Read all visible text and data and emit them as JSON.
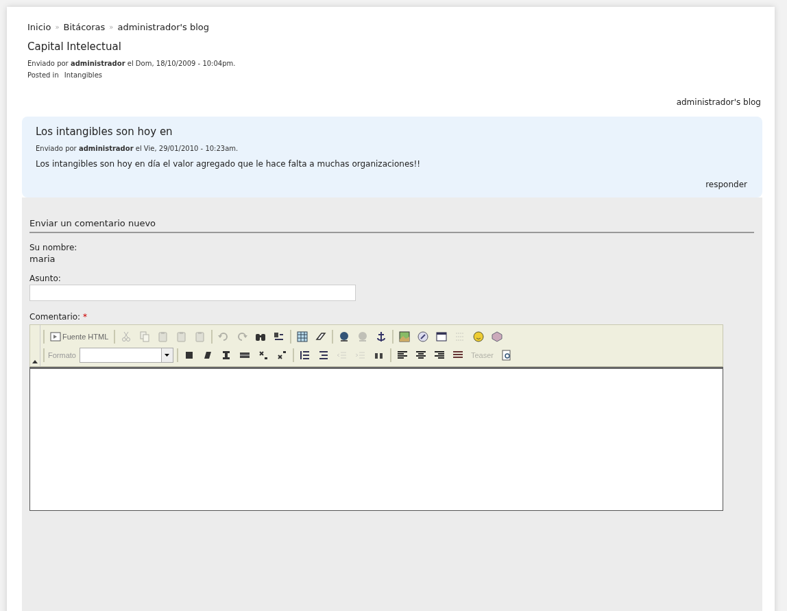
{
  "breadcrumb": [
    {
      "label": "Inicio"
    },
    {
      "label": "Bitácoras"
    },
    {
      "label": "administrador's blog"
    }
  ],
  "breadcrumb_separator": "»",
  "post": {
    "title": "Capital Intelectual",
    "submitted": "Enviado por **administrador** el Dom, 18/10/2009 - 10:04pm.",
    "posted_in_label": "Posted in",
    "term": "Intangibles",
    "blog_link": "administrador's blog"
  },
  "comment": {
    "title": "Los intangibles son hoy en",
    "submitted": "Enviado por **administrador** el Vie, 29/01/2010 - 10:23am.",
    "body": "Los intangibles son hoy en día el valor agregado que le hace falta a muchas organizaciones!!",
    "reply": "responder"
  },
  "form": {
    "heading": "Enviar un comentario nuevo",
    "name_label": "Su nombre:",
    "name_value": "maria",
    "subject_label": "Asunto:",
    "comment_label": "Comentario:",
    "required_mark": "*"
  },
  "toolbar": {
    "rows": [
      [
        {
          "kind": "sep"
        },
        {
          "kind": "button",
          "label": "Fuente HTML",
          "disabled": false
        },
        {
          "kind": "sep"
        },
        {
          "kind": "button",
          "disabled": true
        },
        {
          "kind": "button",
          "disabled": true
        },
        {
          "kind": "button",
          "disabled": true
        },
        {
          "kind": "button",
          "disabled": true
        },
        {
          "kind": "button",
          "disabled": true
        },
        {
          "kind": "sep"
        },
        {
          "kind": "button",
          "disabled": true
        },
        {
          "kind": "button",
          "disabled": true
        },
        {
          "kind": "button",
          "disabled": false
        },
        {
          "kind": "button",
          "disabled": false
        },
        {
          "kind": "sep"
        },
        {
          "kind": "button",
          "disabled": false
        },
        {
          "kind": "button",
          "disabled": false
        },
        {
          "kind": "sep"
        },
        {
          "kind": "button",
          "disabled": false
        },
        {
          "kind": "button",
          "disabled": true
        },
        {
          "kind": "button",
          "disabled": false
        },
        {
          "kind": "sep"
        },
        {
          "kind": "button",
          "disabled": false
        },
        {
          "kind": "button",
          "disabled": false
        },
        {
          "kind": "button",
          "disabled": false
        },
        {
          "kind": "button",
          "disabled": true
        },
        {
          "kind": "button",
          "disabled": false
        },
        {
          "kind": "button",
          "disabled": false
        }
      ],
      [
        {
          "kind": "sep"
        },
        {
          "kind": "select",
          "label": "Formato"
        },
        {
          "kind": "sep"
        },
        {
          "kind": "button",
          "disabled": false
        },
        {
          "kind": "button",
          "disabled": false
        },
        {
          "kind": "button",
          "disabled": false
        },
        {
          "kind": "button",
          "disabled": false
        },
        {
          "kind": "button",
          "disabled": false
        },
        {
          "kind": "button",
          "disabled": false
        },
        {
          "kind": "sep"
        },
        {
          "kind": "button",
          "disabled": false
        },
        {
          "kind": "button",
          "disabled": false
        },
        {
          "kind": "button",
          "disabled": true
        },
        {
          "kind": "button",
          "disabled": true
        },
        {
          "kind": "button",
          "disabled": false
        },
        {
          "kind": "sep"
        },
        {
          "kind": "button",
          "disabled": false
        },
        {
          "kind": "button",
          "disabled": false
        },
        {
          "kind": "button",
          "disabled": false
        },
        {
          "kind": "button",
          "disabled": false
        },
        {
          "kind": "button",
          "label": "Teaser",
          "disabled": true
        },
        {
          "kind": "button",
          "disabled": false
        }
      ]
    ]
  }
}
